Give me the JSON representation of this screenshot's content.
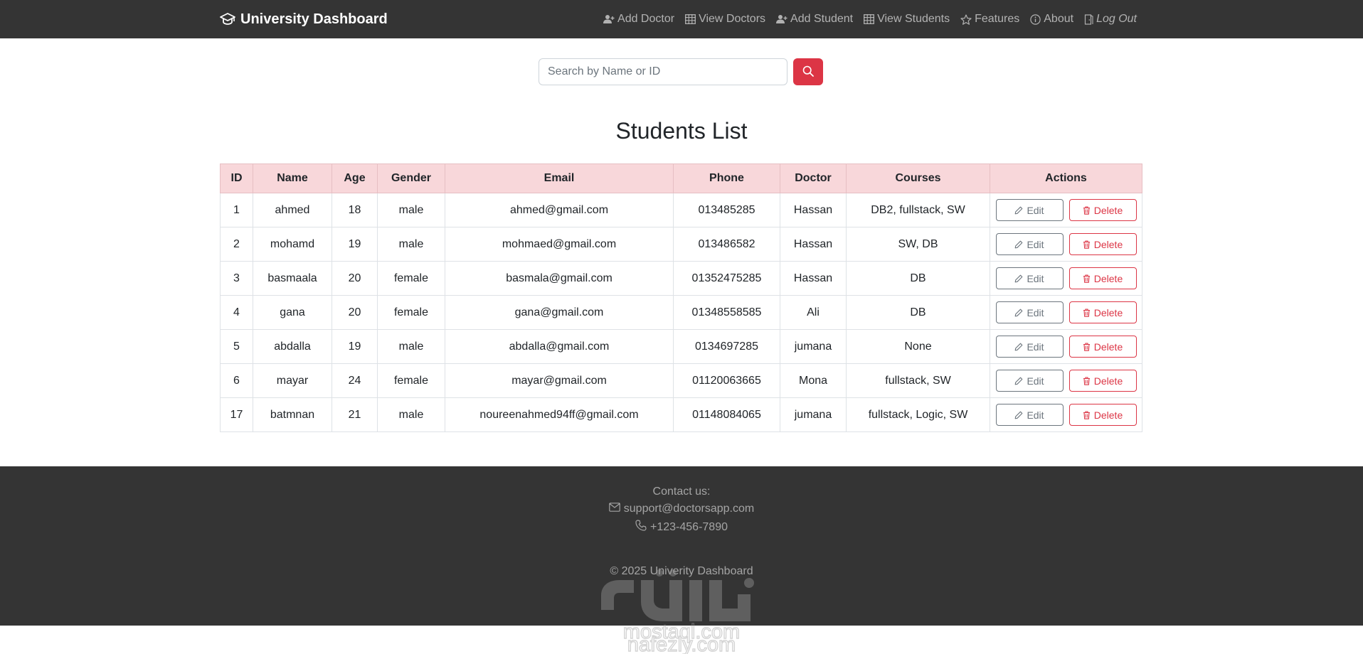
{
  "navbar": {
    "brand": "University Dashboard",
    "links": [
      {
        "label": "Add Doctor",
        "icon": "person-plus-icon"
      },
      {
        "label": "View Doctors",
        "icon": "table-icon"
      },
      {
        "label": "Add Student",
        "icon": "person-plus-icon"
      },
      {
        "label": "View Students",
        "icon": "table-icon"
      },
      {
        "label": "Features",
        "icon": "star-icon"
      },
      {
        "label": "About",
        "icon": "info-circle-icon"
      },
      {
        "label": "Log Out",
        "icon": "door-icon"
      }
    ]
  },
  "search": {
    "placeholder": "Search by Name or ID",
    "value": ""
  },
  "page": {
    "title": "Students List"
  },
  "table": {
    "headers": [
      "ID",
      "Name",
      "Age",
      "Gender",
      "Email",
      "Phone",
      "Doctor",
      "Courses",
      "Actions"
    ],
    "edit_label": "Edit",
    "delete_label": "Delete",
    "rows": [
      {
        "id": "1",
        "name": "ahmed",
        "age": "18",
        "gender": "male",
        "email": "ahmed@gmail.com",
        "phone": "013485285",
        "doctor": "Hassan",
        "courses": "DB2, fullstack, SW"
      },
      {
        "id": "2",
        "name": "mohamd",
        "age": "19",
        "gender": "male",
        "email": "mohmaed@gmail.com",
        "phone": "013486582",
        "doctor": "Hassan",
        "courses": "SW, DB"
      },
      {
        "id": "3",
        "name": "basmaala",
        "age": "20",
        "gender": "female",
        "email": "basmala@gmail.com",
        "phone": "01352475285",
        "doctor": "Hassan",
        "courses": "DB"
      },
      {
        "id": "4",
        "name": "gana",
        "age": "20",
        "gender": "female",
        "email": "gana@gmail.com",
        "phone": "01348558585",
        "doctor": "Ali",
        "courses": "DB"
      },
      {
        "id": "5",
        "name": "abdalla",
        "age": "19",
        "gender": "male",
        "email": "abdalla@gmail.com",
        "phone": "0134697285",
        "doctor": "jumana",
        "courses": "None"
      },
      {
        "id": "6",
        "name": "mayar",
        "age": "24",
        "gender": "female",
        "email": "mayar@gmail.com",
        "phone": "01120063665",
        "doctor": "Mona",
        "courses": "fullstack, SW"
      },
      {
        "id": "17",
        "name": "batmnan",
        "age": "21",
        "gender": "male",
        "email": "noureenahmed94ff@gmail.com",
        "phone": "01148084065",
        "doctor": "jumana",
        "courses": "fullstack, Logic, SW"
      }
    ]
  },
  "footer": {
    "contact_heading": "Contact us:",
    "email": "support@doctorsapp.com",
    "phone": "+123-456-7890",
    "copyright": "© 2025 Univerity Dashboard"
  },
  "watermark": {
    "text": "nafezly.com",
    "text_secondary": "mostaql.com"
  },
  "colors": {
    "navbar_bg": "#343434",
    "accent_red": "#dc3545",
    "table_header_bg": "#f8d7da",
    "footer_bg": "#343434"
  }
}
